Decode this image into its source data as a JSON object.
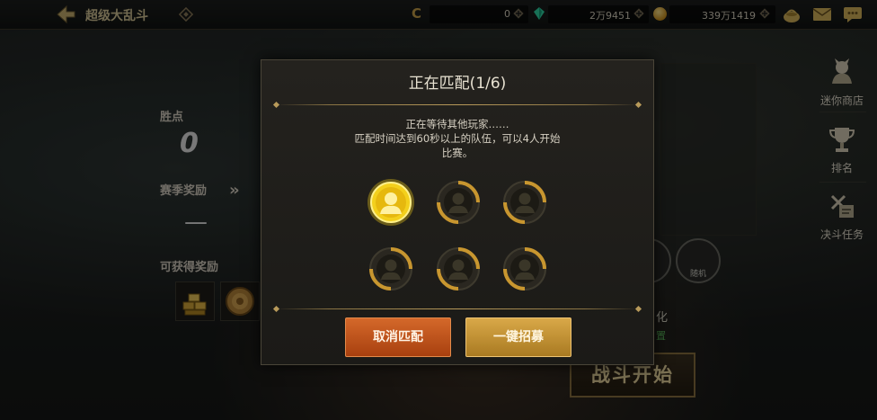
{
  "topbar": {
    "mode_title": "超级大乱斗",
    "c_symbol": "C",
    "currency": [
      {
        "name": "coupon",
        "value": "0"
      },
      {
        "name": "gem",
        "value": "2万9451"
      },
      {
        "name": "gold",
        "value": "339万1419"
      }
    ],
    "icons": [
      "back-arrow-icon",
      "diamond-icon",
      "gem-icon",
      "gold-coin-icon",
      "bag-icon",
      "mail-icon",
      "chat-icon"
    ]
  },
  "left_panel": {
    "points_label": "胜点",
    "points_value": "0",
    "season_reward_label": "赛季奖励",
    "season_reward_value": "—",
    "obtainable_label": "可获得奖励"
  },
  "side_menu": [
    {
      "label": "迷你商店",
      "icon": "shop-icon"
    },
    {
      "label": "排名",
      "icon": "trophy-icon"
    },
    {
      "label": "决斗任务",
      "icon": "quest-icon"
    }
  ],
  "behind": {
    "start_button": "战斗开始",
    "circle_label": "随机",
    "text1": "化",
    "text2": "置"
  },
  "dialog": {
    "title": "正在匹配(1/6)",
    "line1": "正在等待其他玩家……",
    "line2": "匹配时间达到60秒以上的队伍，可以4人开始",
    "line3": "比赛。",
    "slots_filled": 1,
    "slots_total": 6,
    "cancel_label": "取消匹配",
    "recruit_label": "一键招募"
  },
  "colors": {
    "accent_gold": "#b89a5a",
    "cancel_button": "#c45520",
    "recruit_button": "#c8962f",
    "active_slot": "#f5d21a"
  }
}
